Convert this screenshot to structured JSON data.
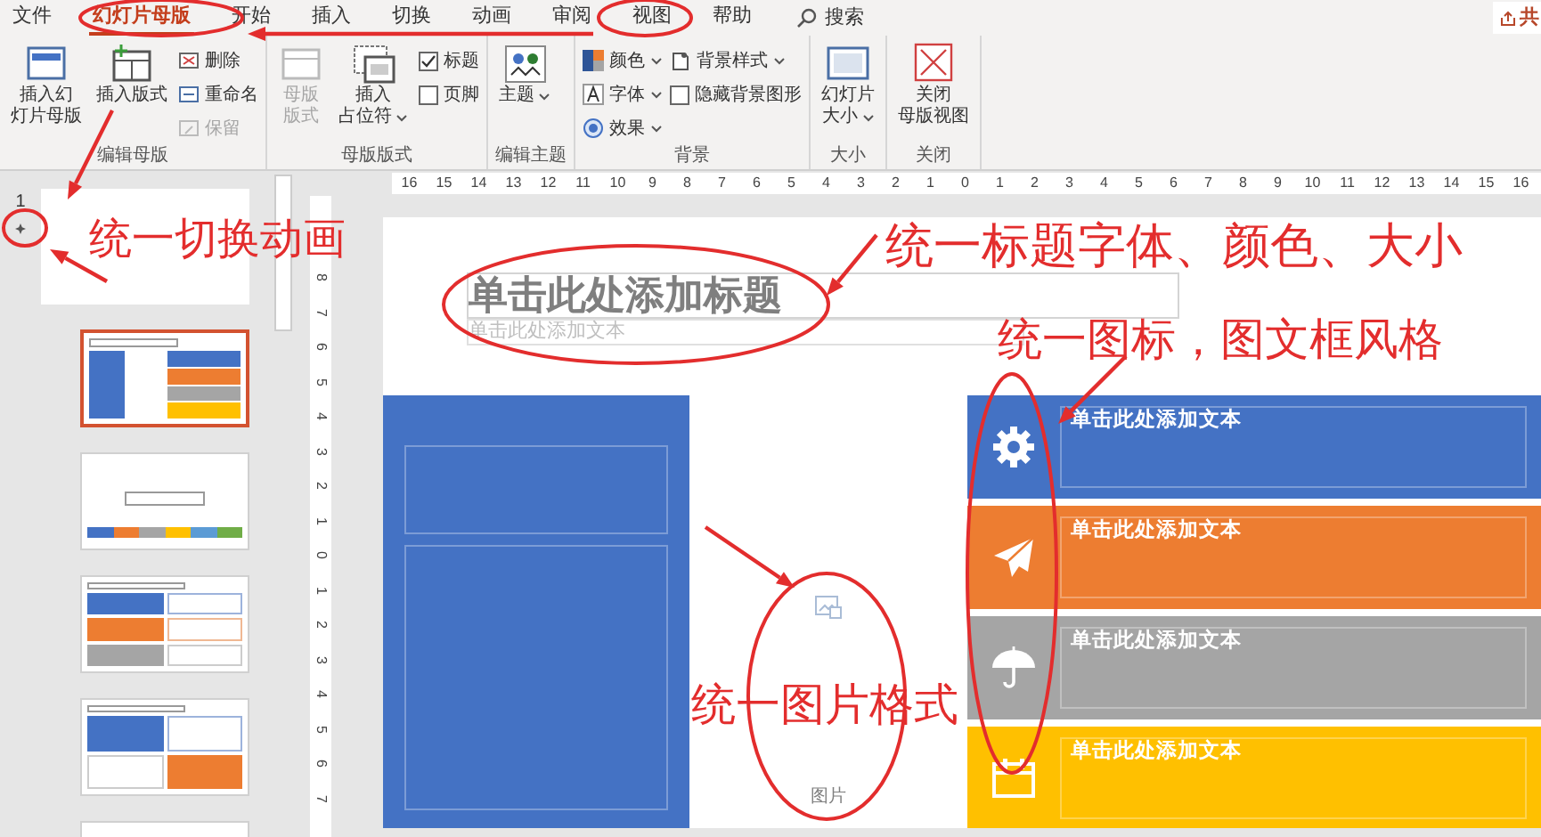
{
  "tabs": [
    {
      "label": "文件",
      "selected": false
    },
    {
      "label": "幻灯片母版",
      "selected": true
    },
    {
      "label": "开始",
      "selected": false
    },
    {
      "label": "插入",
      "selected": false
    },
    {
      "label": "切换",
      "selected": false
    },
    {
      "label": "动画",
      "selected": false
    },
    {
      "label": "审阅",
      "selected": false
    },
    {
      "label": "视图",
      "selected": false
    },
    {
      "label": "帮助",
      "selected": false
    }
  ],
  "search": {
    "label": "搜索"
  },
  "share_button": {
    "label": "共"
  },
  "ribbon_groups": [
    {
      "label": "编辑母版",
      "items": [
        {
          "kind": "large",
          "lines": [
            "插入幻",
            "灯片母版"
          ],
          "disabled": false,
          "dropdown": false
        },
        {
          "kind": "large",
          "lines": [
            "插入版式"
          ],
          "disabled": false,
          "dropdown": false
        },
        {
          "kind": "small",
          "label": "删除",
          "disabled": false,
          "dropdown": false
        },
        {
          "kind": "small",
          "label": "重命名",
          "disabled": false,
          "dropdown": false
        },
        {
          "kind": "small",
          "label": "保留",
          "disabled": true,
          "dropdown": false
        }
      ]
    },
    {
      "label": "母版版式",
      "items": [
        {
          "kind": "large",
          "lines": [
            "母版",
            "版式"
          ],
          "disabled": true,
          "dropdown": false
        },
        {
          "kind": "large",
          "lines": [
            "插入",
            "占位符"
          ],
          "disabled": false,
          "dropdown": true
        },
        {
          "kind": "checkbox",
          "label": "标题",
          "checked": true
        },
        {
          "kind": "checkbox",
          "label": "页脚",
          "checked": false
        }
      ]
    },
    {
      "label": "编辑主题",
      "items": [
        {
          "kind": "large",
          "lines": [
            "主题"
          ],
          "disabled": false,
          "dropdown": true
        }
      ]
    },
    {
      "label": "背景",
      "items": [
        {
          "kind": "small",
          "label": "颜色",
          "disabled": false,
          "dropdown": true
        },
        {
          "kind": "small",
          "label": "字体",
          "disabled": false,
          "dropdown": true
        },
        {
          "kind": "small",
          "label": "效果",
          "disabled": false,
          "dropdown": true
        },
        {
          "kind": "small",
          "label": "背景样式",
          "disabled": false,
          "dropdown": true
        },
        {
          "kind": "checkbox",
          "label": "隐藏背景图形",
          "checked": false
        }
      ]
    },
    {
      "label": "大小",
      "items": [
        {
          "kind": "large",
          "lines": [
            "幻灯片",
            "大小"
          ],
          "disabled": false,
          "dropdown": true
        }
      ]
    },
    {
      "label": "关闭",
      "items": [
        {
          "kind": "large",
          "lines": [
            "关闭",
            "母版视图"
          ],
          "disabled": false,
          "dropdown": false
        }
      ]
    }
  ],
  "slide_panel": {
    "master": {
      "number": "1",
      "has_transition": true,
      "selected": false
    },
    "layouts": [
      {
        "kind": "blocks",
        "selected": true
      },
      {
        "kind": "title_strip",
        "selected": false
      },
      {
        "kind": "rows",
        "selected": false
      },
      {
        "kind": "grid",
        "selected": false
      },
      {
        "kind": "blank",
        "selected": false
      }
    ]
  },
  "rulers": {
    "horizontal": [
      "16",
      "15",
      "14",
      "13",
      "12",
      "11",
      "10",
      "9",
      "8",
      "7",
      "6",
      "5",
      "4",
      "3",
      "2",
      "1",
      "0",
      "1",
      "2",
      "3",
      "4",
      "5",
      "6",
      "7",
      "8",
      "9",
      "10",
      "11",
      "12",
      "13",
      "14",
      "15",
      "16"
    ],
    "vertical": [
      "8",
      "7",
      "6",
      "5",
      "4",
      "3",
      "2",
      "1",
      "0",
      "1",
      "2",
      "3",
      "4",
      "5",
      "6",
      "7"
    ]
  },
  "slide": {
    "title_placeholder": "单击此处添加标题",
    "text_placeholder": "单击此处添加文本",
    "picture_label": "图片",
    "bars": [
      {
        "text": "单击此处添加文本",
        "color": "#4472c4"
      },
      {
        "text": "单击此处添加文本",
        "color": "#ed7d31"
      },
      {
        "text": "单击此处添加文本",
        "color": "#a5a5a5"
      },
      {
        "text": "单击此处添加文本",
        "color": "#ffc000"
      }
    ]
  },
  "annotations": [
    {
      "text": "统一切换动画"
    },
    {
      "text": "统一标题字体、颜色、大小"
    },
    {
      "text": "统一图标，图文框风格"
    },
    {
      "text": "统一图片格式"
    }
  ]
}
